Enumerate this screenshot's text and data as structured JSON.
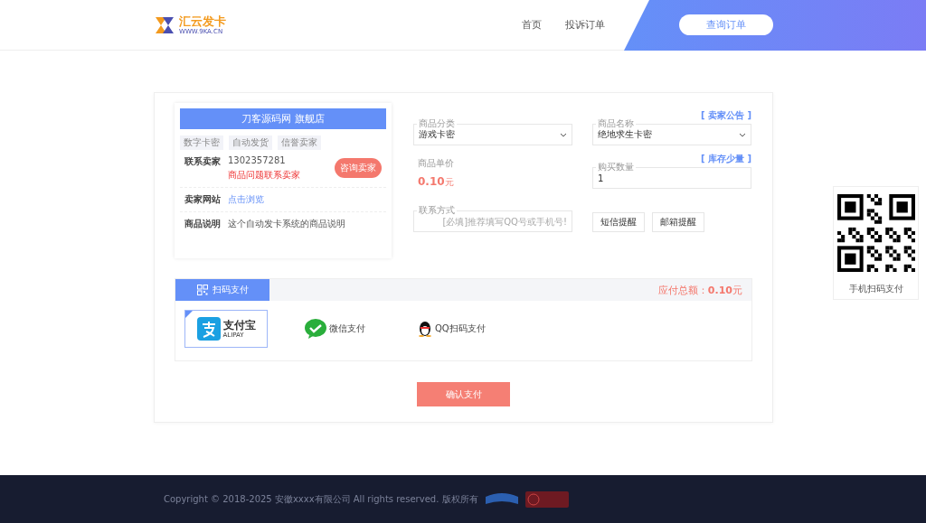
{
  "header": {
    "logo_text": "汇云发卡",
    "logo_sub": "WWW.9KA.CN",
    "nav": [
      {
        "label": "首页",
        "selected": false
      },
      {
        "label": "投诉订单",
        "selected": false
      }
    ],
    "query_button": "查询订单"
  },
  "store": {
    "title": "刀客源码网 旗舰店",
    "tags": [
      "数字卡密",
      "自动发货",
      "信誉卖家"
    ],
    "contact": {
      "label": "联系卖家",
      "value": "1302357281",
      "note": "商品问题联系卖家",
      "button": "咨询卖家"
    },
    "website": {
      "label": "卖家网站",
      "link": "点击浏览"
    },
    "description": {
      "label": "商品说明",
      "value": "这个自动发卡系统的商品说明"
    }
  },
  "form": {
    "category": {
      "label": "商品分类",
      "value": "游戏卡密"
    },
    "product": {
      "label": "商品名称",
      "value": "绝地求生卡密",
      "link": "[ 卖家公告 ]"
    },
    "price": {
      "label": "商品单价",
      "amount": "0.10",
      "unit": "元"
    },
    "quantity": {
      "label": "购买数量",
      "value": "1",
      "link": "[ 库存少量 ]"
    },
    "contact": {
      "label": "联系方式",
      "placeholder": "[必填]推荐填写QQ号或手机号!"
    },
    "reminders": [
      {
        "label": "短信提醒",
        "checked": false
      },
      {
        "label": "邮箱提醒",
        "checked": false
      }
    ]
  },
  "payment": {
    "tab": "扫码支付",
    "total_label": "应付总额：",
    "total_amount": "0.10",
    "total_unit": "元",
    "methods": [
      {
        "kind": "alipay",
        "label": "支付宝",
        "sub": "ALIPAY",
        "selected": true
      },
      {
        "kind": "wechat",
        "label": "微信支付",
        "selected": false
      },
      {
        "kind": "qq",
        "label": "QQ扫码支付",
        "selected": false
      }
    ],
    "confirm": "确认支付"
  },
  "qr_panel": {
    "caption": "手机扫码支付"
  },
  "footer": {
    "copyright": "Copyright © 2018-2025 安徽xxxx有限公司 All rights reserved. 版权所有"
  }
}
